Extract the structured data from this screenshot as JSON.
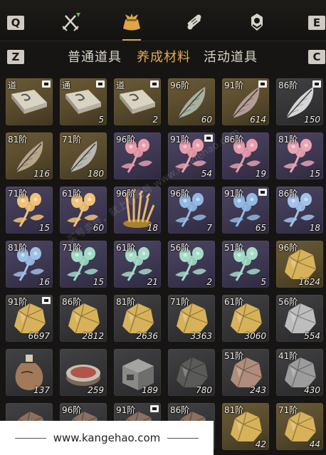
{
  "header": {
    "left_key": "Q",
    "right_key": "E",
    "categories": [
      {
        "icon": "crossed-swords-icon",
        "active": false
      },
      {
        "icon": "pouch-icon",
        "active": true
      },
      {
        "icon": "scroll-icon",
        "active": false
      },
      {
        "icon": "emblem-icon",
        "active": false
      }
    ]
  },
  "subtabs": {
    "left_key": "Z",
    "right_key": "C",
    "items": [
      {
        "label": "普通道具",
        "active": false
      },
      {
        "label": "养成材料",
        "active": true
      },
      {
        "label": "活动道具",
        "active": false
      }
    ]
  },
  "items": [
    {
      "tier": "道",
      "qty": "",
      "lock": true,
      "bg": "gold",
      "kind": "book"
    },
    {
      "tier": "通",
      "qty": "5",
      "lock": true,
      "bg": "gold",
      "kind": "book"
    },
    {
      "tier": "道",
      "qty": "2",
      "lock": true,
      "bg": "gold",
      "kind": "book"
    },
    {
      "tier": "96阶",
      "qty": "60",
      "lock": false,
      "bg": "gold",
      "kind": "feather",
      "color": "#a8b09e"
    },
    {
      "tier": "91阶",
      "qty": "614",
      "lock": true,
      "bg": "gold",
      "kind": "feather",
      "color": "#b59c97"
    },
    {
      "tier": "86阶",
      "qty": "150",
      "lock": true,
      "bg": "gray",
      "kind": "feather",
      "color": "#d6d6d6"
    },
    {
      "tier": "81阶",
      "qty": "116",
      "lock": false,
      "bg": "gold",
      "kind": "feather",
      "color": "#b7a48a"
    },
    {
      "tier": "71阶",
      "qty": "180",
      "lock": false,
      "bg": "gold",
      "kind": "feather",
      "color": "#b9b7b2"
    },
    {
      "tier": "96阶",
      "qty": "",
      "lock": false,
      "bg": "purple",
      "kind": "flower",
      "color": "#e79cac"
    },
    {
      "tier": "91阶",
      "qty": "54",
      "lock": true,
      "bg": "purple",
      "kind": "flower",
      "color": "#e79cac"
    },
    {
      "tier": "86阶",
      "qty": "19",
      "lock": false,
      "bg": "purple",
      "kind": "flower",
      "color": "#e79cac"
    },
    {
      "tier": "81阶",
      "qty": "15",
      "lock": false,
      "bg": "purple",
      "kind": "flower",
      "color": "#e8a4b3"
    },
    {
      "tier": "71阶",
      "qty": "15",
      "lock": false,
      "bg": "purple",
      "kind": "flower",
      "color": "#f0c27a"
    },
    {
      "tier": "61阶",
      "qty": "60",
      "lock": false,
      "bg": "purple",
      "kind": "flower",
      "color": "#f0c27a"
    },
    {
      "tier": "96阶",
      "qty": "18",
      "lock": false,
      "bg": "purple",
      "kind": "wheat",
      "color": "#e8b76a"
    },
    {
      "tier": "96阶",
      "qty": "7",
      "lock": false,
      "bg": "purple",
      "kind": "flower",
      "color": "#93b8e3"
    },
    {
      "tier": "91阶",
      "qty": "65",
      "lock": true,
      "bg": "purple",
      "kind": "flower",
      "color": "#93b8e3"
    },
    {
      "tier": "86阶",
      "qty": "18",
      "lock": false,
      "bg": "purple",
      "kind": "flower",
      "color": "#a2c2ea"
    },
    {
      "tier": "81阶",
      "qty": "16",
      "lock": false,
      "bg": "purple",
      "kind": "flower",
      "color": "#9fc0e6"
    },
    {
      "tier": "71阶",
      "qty": "15",
      "lock": false,
      "bg": "purple",
      "kind": "flower",
      "color": "#9fdac4"
    },
    {
      "tier": "61阶",
      "qty": "21",
      "lock": false,
      "bg": "purple",
      "kind": "flower",
      "color": "#a5dbc6"
    },
    {
      "tier": "56阶",
      "qty": "2",
      "lock": false,
      "bg": "purple",
      "kind": "flower",
      "color": "#a5dbc6"
    },
    {
      "tier": "51阶",
      "qty": "5",
      "lock": false,
      "bg": "purple",
      "kind": "flower",
      "color": "#a5dbc6"
    },
    {
      "tier": "96阶",
      "qty": "1624",
      "lock": false,
      "bg": "gold",
      "kind": "ore",
      "color": "#d7b25a"
    },
    {
      "tier": "91阶",
      "qty": "6697",
      "lock": true,
      "bg": "gray",
      "kind": "ore",
      "color": "#d7b25a"
    },
    {
      "tier": "86阶",
      "qty": "2812",
      "lock": false,
      "bg": "gray",
      "kind": "ore",
      "color": "#d7b25a"
    },
    {
      "tier": "81阶",
      "qty": "2636",
      "lock": false,
      "bg": "gray",
      "kind": "ore",
      "color": "#d7b25a"
    },
    {
      "tier": "71阶",
      "qty": "3363",
      "lock": false,
      "bg": "gray",
      "kind": "ore",
      "color": "#d7b25a"
    },
    {
      "tier": "61阶",
      "qty": "3060",
      "lock": false,
      "bg": "gray",
      "kind": "ore",
      "color": "#d7b25a"
    },
    {
      "tier": "56阶",
      "qty": "554",
      "lock": false,
      "bg": "gray",
      "kind": "ore",
      "color": "#bdbdbd"
    },
    {
      "tier": "",
      "qty": "137",
      "lock": false,
      "bg": "gray",
      "kind": "flask",
      "color": "#a07a5a"
    },
    {
      "tier": "",
      "qty": "259",
      "lock": false,
      "bg": "gray",
      "kind": "inkstone",
      "color": "#b0554a"
    },
    {
      "tier": "",
      "qty": "189",
      "lock": false,
      "bg": "gray",
      "kind": "box",
      "color": "#8a8a88"
    },
    {
      "tier": "",
      "qty": "780",
      "lock": false,
      "bg": "gray",
      "kind": "ore",
      "color": "#5a5a58"
    },
    {
      "tier": "51阶",
      "qty": "243",
      "lock": false,
      "bg": "gray",
      "kind": "ore",
      "color": "#b08c7c"
    },
    {
      "tier": "41阶",
      "qty": "430",
      "lock": false,
      "bg": "gray",
      "kind": "ore",
      "color": "#9c9c9c"
    },
    {
      "tier": "",
      "qty": "",
      "lock": false,
      "bg": "gray",
      "kind": "ore",
      "color": "#8a7060"
    },
    {
      "tier": "96阶",
      "qty": "",
      "lock": false,
      "bg": "gray",
      "kind": "ore",
      "color": "#8a7060"
    },
    {
      "tier": "91阶",
      "qty": "",
      "lock": true,
      "bg": "gray",
      "kind": "ore",
      "color": "#8a7060"
    },
    {
      "tier": "86阶",
      "qty": "",
      "lock": false,
      "bg": "gray",
      "kind": "ore",
      "color": "#8a7060"
    },
    {
      "tier": "81阶",
      "qty": "42",
      "lock": false,
      "bg": "gold",
      "kind": "ore",
      "color": "#d7b25a"
    },
    {
      "tier": "71阶",
      "qty": "44",
      "lock": false,
      "bg": "gold",
      "kind": "ore",
      "color": "#d7b25a"
    }
  ],
  "watermark": {
    "text": "买号卖号，就上看看号 www.kangehao.com"
  },
  "footer": {
    "url": "www.kangehao.com"
  }
}
